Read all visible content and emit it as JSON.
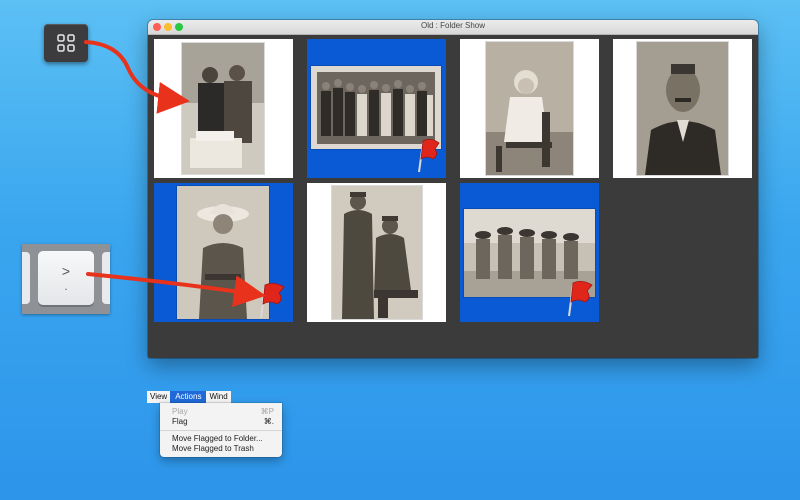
{
  "window": {
    "title": "Old : Folder Show"
  },
  "thumbnails": [
    {
      "name": "Couple cutting cake",
      "selected": false,
      "flagged": false
    },
    {
      "name": "Group portrait",
      "selected": true,
      "flagged": true
    },
    {
      "name": "Child on chair",
      "selected": false,
      "flagged": false
    },
    {
      "name": "Man with moustache",
      "selected": false,
      "flagged": false
    },
    {
      "name": "Woman in hat",
      "selected": true,
      "flagged": true
    },
    {
      "name": "Two soldiers",
      "selected": false,
      "flagged": false
    },
    {
      "name": "Women on beach",
      "selected": true,
      "flagged": true
    }
  ],
  "callouts": {
    "grid_key_icon": "grid-icon",
    "keyboard_key": {
      "main": ">",
      "sub": "."
    }
  },
  "menubar": {
    "items": [
      "View",
      "Actions",
      "Wind"
    ]
  },
  "menu": {
    "items": [
      {
        "label": "Play",
        "shortcut": "⌘P",
        "enabled": false
      },
      {
        "label": "Flag",
        "shortcut": "⌘.",
        "enabled": true
      },
      {
        "label": "Move Flagged to Folder...",
        "shortcut": "",
        "enabled": true
      },
      {
        "label": "Move Flagged to Trash",
        "shortcut": "",
        "enabled": true
      }
    ]
  },
  "colors": {
    "selection": "#0a5ad6",
    "arrow": "#e8321c",
    "window_bg": "#3b3b3b"
  }
}
